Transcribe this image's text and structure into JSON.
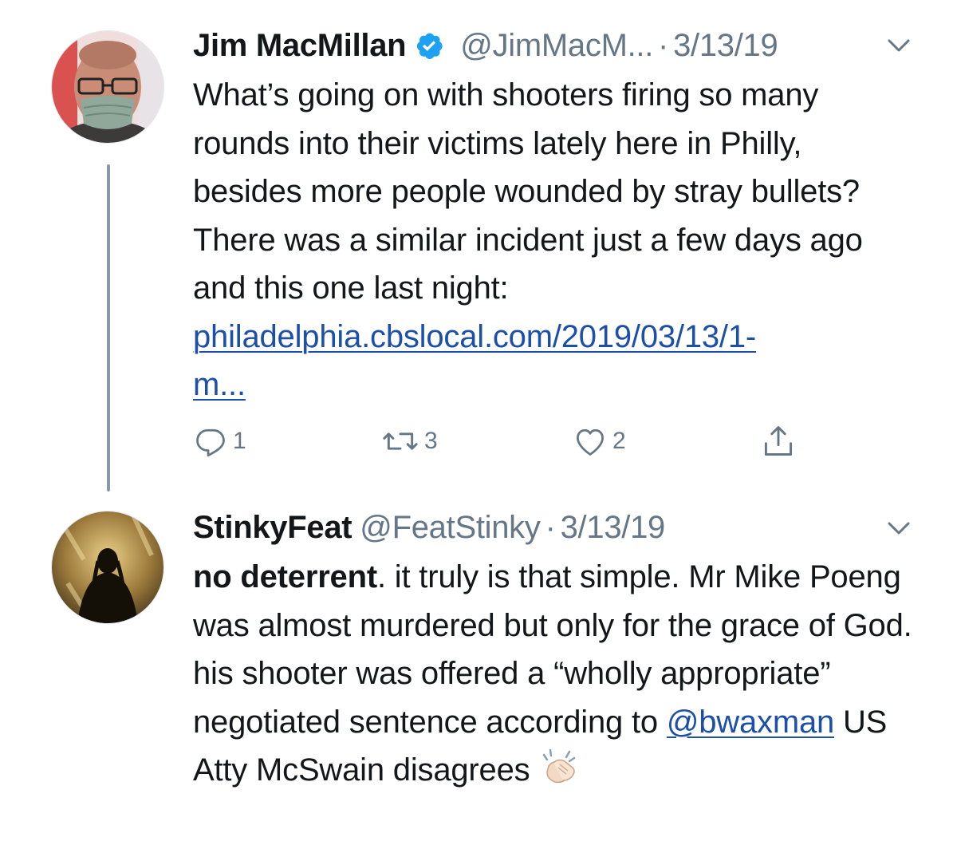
{
  "tweets": [
    {
      "name": "Jim MacMillan",
      "handle": "@JimMacM...",
      "separator": "·",
      "date": "3/13/19",
      "verified": true,
      "avatar_icon": "avatar-man-with-face-mask",
      "text": "What’s going on with shooters firing so many rounds into their victims lately here in Philly, besides more people wounded by stray bullets? There was a similar incident just a few days ago and this one last night:",
      "link": "philadelphia.cbslocal.com/2019/03/13/1-m...",
      "link_line1": "philadelphia.cbslocal.com/2019/03/13/1-",
      "link_line2": "m...",
      "actions": {
        "reply_count": "1",
        "retweet_count": "3",
        "like_count": "2"
      }
    },
    {
      "name": "StinkyFeat",
      "handle": "@FeatStinky",
      "separator": "·",
      "date": "3/13/19",
      "avatar_icon": "avatar-dark-silhouette",
      "text_bold": "no deterrent",
      "text_part1": ". it truly is that simple. Mr Mike Poeng was almost murdered but only for the grace of God. his shooter was offered a “wholly appropriate” negotiated sentence according to ",
      "mention": "@bwaxman",
      "text_part2": " US Atty McSwain disagrees",
      "emoji": "clapping-hands-emoji"
    }
  ],
  "colors": {
    "text": "#14171a",
    "secondary": "#657786",
    "link": "#1b4fa8",
    "verified": "#1da1f2",
    "thread_line": "#8899a6"
  }
}
